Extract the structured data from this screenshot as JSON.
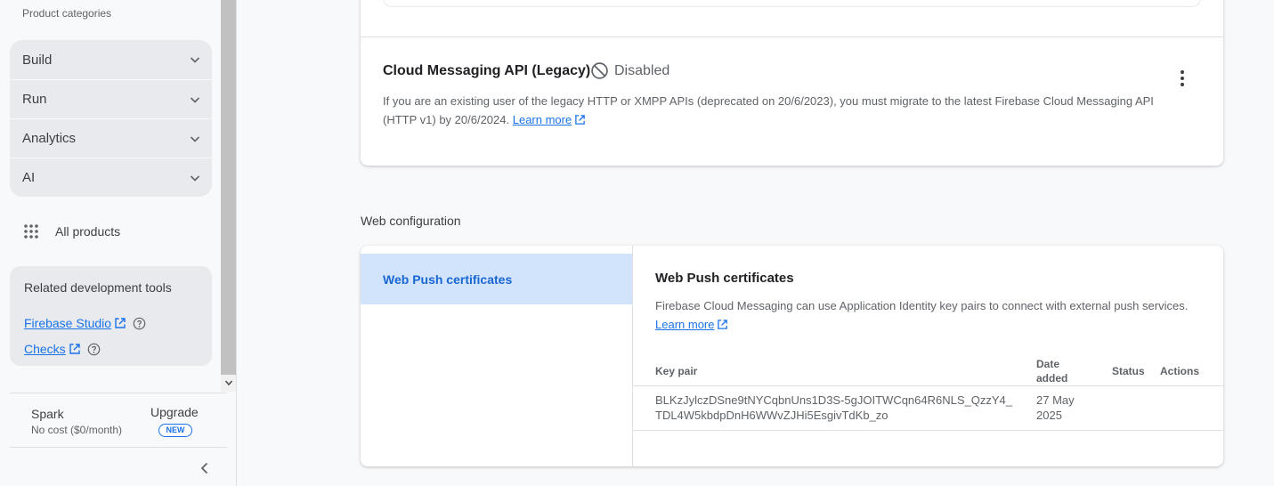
{
  "sidebar": {
    "heading": "Product categories",
    "categories": [
      {
        "label": "Build"
      },
      {
        "label": "Run"
      },
      {
        "label": "Analytics"
      },
      {
        "label": "AI"
      }
    ],
    "all_products": "All products",
    "related": {
      "title": "Related development tools",
      "links": [
        {
          "label": "Firebase Studio"
        },
        {
          "label": "Checks"
        }
      ]
    },
    "plan": {
      "name": "Spark",
      "cost": "No cost ($0/month)",
      "upgrade": "Upgrade",
      "badge": "NEW"
    }
  },
  "main": {
    "api_card": {
      "title": "Cloud Messaging API (Legacy)",
      "status": "Disabled",
      "description": "If you are an existing user of the legacy HTTP or XMPP APIs (deprecated on 20/6/2023), you must migrate to the latest Firebase Cloud Messaging API (HTTP v1) by 20/6/2024.",
      "learn_more": "Learn more"
    },
    "web_config": {
      "section_label": "Web configuration",
      "nav_item": "Web Push certificates",
      "title": "Web Push certificates",
      "description": "Firebase Cloud Messaging can use Application Identity key pairs to connect with external push services.",
      "learn_more": "Learn more",
      "table": {
        "headers": {
          "key_pair": "Key pair",
          "date_added_1": "Date",
          "date_added_2": "added",
          "status": "Status",
          "actions": "Actions"
        },
        "rows": [
          {
            "key_line1": "BLKzJylczDSne9tNYCqbnUns1D3S-5gJOITWCqn64R6NLS_QzzY4_",
            "key_line2": "TDL4W5kbdpDnH6WWvZJHi5EsgivTdKb_zo",
            "date_line1": "27 May",
            "date_line2": "2025",
            "status": "",
            "actions": ""
          }
        ]
      }
    }
  },
  "colors": {
    "link": "#1a73e8",
    "selected_nav_bg": "#d2e3fc",
    "selected_nav_text": "#1967d2"
  }
}
